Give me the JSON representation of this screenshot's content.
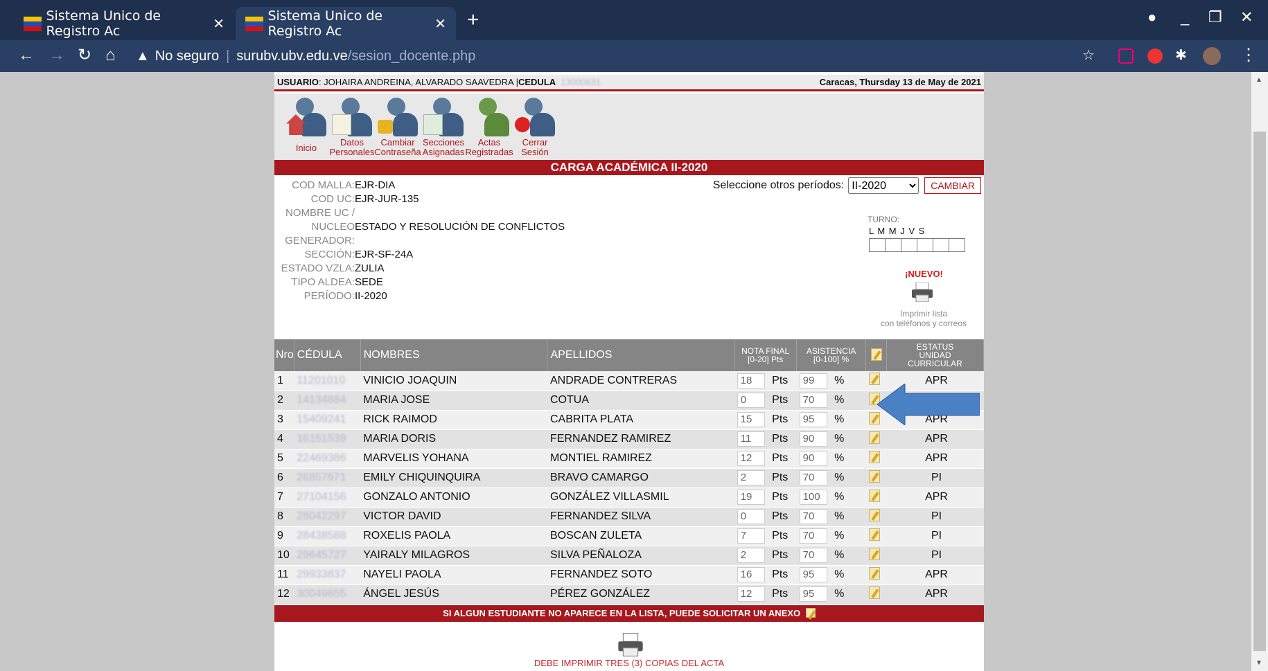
{
  "browser": {
    "tabs": [
      {
        "title": "Sistema Unico de Registro Ac",
        "active": false
      },
      {
        "title": "Sistema Unico de Registro Ac",
        "active": true
      }
    ],
    "url_secure_label": "No seguro",
    "url_host": "surubv.ubv.edu.ve",
    "url_path": "/sesion_docente.php"
  },
  "user": {
    "label": "USUARIO",
    "name": ": JOHAIRA ANDREINA, ALVARADO SAAVEDRA | ",
    "cedula_label": "CEDULA",
    "cedula_value": ": 13000631",
    "date": "Caracas, Thursday 13 de May de 2021"
  },
  "menu": [
    {
      "label": "Inicio"
    },
    {
      "label": "Datos Personales"
    },
    {
      "label": "Cambiar Contraseña"
    },
    {
      "label": "Secciones Asignadas"
    },
    {
      "label": "Actas Registradas"
    },
    {
      "label": "Cerrar Sesión"
    }
  ],
  "title": "CARGA ACADÉMICA II-2020",
  "period_selector": {
    "label": "Seleccione otros períodos:",
    "selected": "II-2020",
    "button": "CAMBIAR"
  },
  "info": {
    "cod_malla": {
      "k": "COD MALLA:",
      "v": "EJR-DIA"
    },
    "cod_uc": {
      "k": "COD UC:",
      "v": "EJR-JUR-135"
    },
    "nombre_uc_a": {
      "k": "NOMBRE UC /"
    },
    "nombre_uc_b": {
      "k": "NUCLEO",
      "v": "ESTADO Y RESOLUCIÓN DE CONFLICTOS"
    },
    "generador": {
      "k": "GENERADOR:"
    },
    "seccion": {
      "k": "SECCIÓN:",
      "v": "EJR-SF-24A"
    },
    "estado": {
      "k": "ESTADO VZLA:",
      "v": "ZULIA"
    },
    "tipo_aldea": {
      "k": "TIPO ALDEA:",
      "v": "SEDE"
    },
    "periodo": {
      "k": "PERÍODO:",
      "v": "II-2020"
    }
  },
  "turno": {
    "label": "TURNO:",
    "days": "L M M J V S",
    "nuevo": "¡NUEVO!",
    "print_list_1": "Imprimir lista",
    "print_list_2": "con teléfonos y correos"
  },
  "table": {
    "headers": {
      "nro": "Nro",
      "cedula": "CÉDULA",
      "nombres": "NOMBRES",
      "apellidos": "APELLIDOS",
      "nota_1": "NOTA FINAL",
      "nota_2": "[0-20] Pts",
      "asis_1": "ASISTENCIA",
      "asis_2": "[0-100] %",
      "status_1": "ESTATUS",
      "status_2": "UNIDAD",
      "status_3": "CURRICULAR"
    },
    "pts_unit": "Pts",
    "pct_unit": "%",
    "rows": [
      {
        "nro": "1",
        "cedula": "11201010",
        "nombres": "VINICIO JOAQUIN",
        "apellidos": "ANDRADE CONTRERAS",
        "nota": "18",
        "asistencia": "99",
        "status": "APR"
      },
      {
        "nro": "2",
        "cedula": "14134884",
        "nombres": "MARIA JOSE",
        "apellidos": "COTUA",
        "nota": "0",
        "asistencia": "70",
        "status": ""
      },
      {
        "nro": "3",
        "cedula": "15409241",
        "nombres": "RICK RAIMOD",
        "apellidos": "CABRITA PLATA",
        "nota": "15",
        "asistencia": "95",
        "status": "APR"
      },
      {
        "nro": "4",
        "cedula": "16151539",
        "nombres": "MARIA DORIS",
        "apellidos": "FERNANDEZ RAMIREZ",
        "nota": "11",
        "asistencia": "90",
        "status": "APR"
      },
      {
        "nro": "5",
        "cedula": "22469386",
        "nombres": "MARVELIS YOHANA",
        "apellidos": "MONTIEL RAMIREZ",
        "nota": "12",
        "asistencia": "90",
        "status": "APR"
      },
      {
        "nro": "6",
        "cedula": "26857671",
        "nombres": "EMILY CHIQUINQUIRA",
        "apellidos": "BRAVO CAMARGO",
        "nota": "2",
        "asistencia": "70",
        "status": "PI"
      },
      {
        "nro": "7",
        "cedula": "27104156",
        "nombres": "GONZALO ANTONIO",
        "apellidos": "GONZÁLEZ VILLASMIL",
        "nota": "19",
        "asistencia": "100",
        "status": "APR"
      },
      {
        "nro": "8",
        "cedula": "28042297",
        "nombres": "VICTOR DAVID",
        "apellidos": "FERNANDEZ SILVA",
        "nota": "0",
        "asistencia": "70",
        "status": "PI"
      },
      {
        "nro": "9",
        "cedula": "28438588",
        "nombres": "ROXELIS PAOLA",
        "apellidos": "BOSCAN ZULETA",
        "nota": "7",
        "asistencia": "70",
        "status": "PI"
      },
      {
        "nro": "10",
        "cedula": "29645727",
        "nombres": "YAIRALY MILAGROS",
        "apellidos": "SILVA PEÑALOZA",
        "nota": "2",
        "asistencia": "70",
        "status": "PI"
      },
      {
        "nro": "11",
        "cedula": "29933837",
        "nombres": "NAYELI PAOLA",
        "apellidos": "FERNANDEZ SOTO",
        "nota": "16",
        "asistencia": "95",
        "status": "APR"
      },
      {
        "nro": "12",
        "cedula": "30049655",
        "nombres": "ÁNGEL JESÚS",
        "apellidos": "PÉREZ GONZÁLEZ",
        "nota": "12",
        "asistencia": "95",
        "status": "APR"
      }
    ]
  },
  "anexo_notice": "SI ALGUN ESTUDIANTE NO APARECE EN LA LISTA, PUEDE SOLICITAR UN ANEXO",
  "print_notice": "DEBE IMPRIMIR TRES (3) COPIAS DEL ACTA",
  "colors": {
    "accent": "#a7171e",
    "chrome": "#2a3f64",
    "arrow": "#4a80c4"
  }
}
